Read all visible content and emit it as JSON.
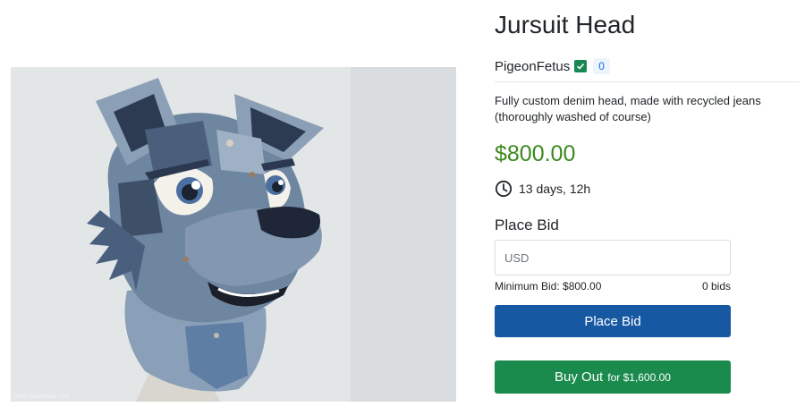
{
  "listing": {
    "title": "Jursuit Head",
    "image_alt": "Denim fursuit head photo",
    "watermark": "TheFursuitHive.com"
  },
  "seller": {
    "name": "PigeonFetus",
    "verified_icon": "check-square-icon",
    "rating_count": "0"
  },
  "description": "Fully custom denim head, made with recycled jeans (thoroughly washed of course)",
  "price": "$800.00",
  "time_left": "13 days, 12h",
  "bid": {
    "heading": "Place Bid",
    "input_placeholder": "USD",
    "minimum_label": "Minimum Bid: $800.00",
    "bids_count": "0 bids",
    "place_button": "Place Bid"
  },
  "buyout": {
    "label": "Buy Out",
    "for_text": "for $1,600.00"
  },
  "colors": {
    "price_green": "#3b8a1d",
    "place_bid_blue": "#1758a3",
    "buyout_green": "#1a8a4d",
    "verified_green": "#198754"
  }
}
